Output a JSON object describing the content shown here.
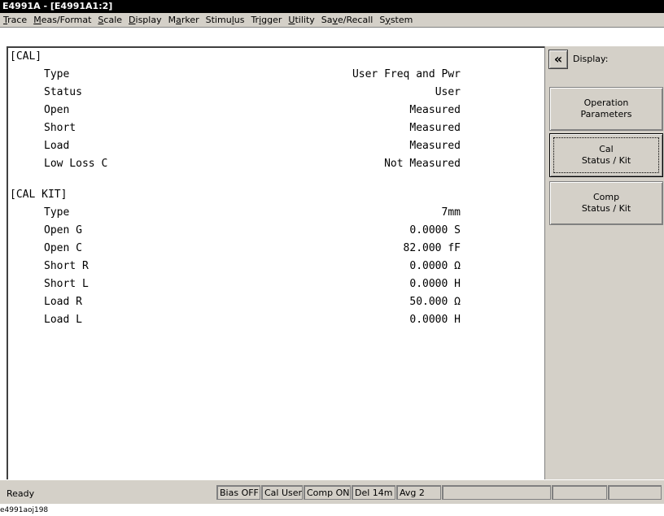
{
  "window": {
    "title": "E4991A - [E4991A1:2]"
  },
  "menu": [
    {
      "pre": "",
      "ul": "T",
      "post": "race"
    },
    {
      "pre": "",
      "ul": "M",
      "post": "eas/Format"
    },
    {
      "pre": "",
      "ul": "S",
      "post": "cale"
    },
    {
      "pre": "",
      "ul": "D",
      "post": "isplay"
    },
    {
      "pre": "M",
      "ul": "a",
      "post": "rker"
    },
    {
      "pre": "Stimu",
      "ul": "l",
      "post": "us"
    },
    {
      "pre": "Tr",
      "ul": "i",
      "post": "gger"
    },
    {
      "pre": "",
      "ul": "U",
      "post": "tility"
    },
    {
      "pre": "Sa",
      "ul": "v",
      "post": "e/Recall"
    },
    {
      "pre": "S",
      "ul": "y",
      "post": "stem"
    }
  ],
  "cal": {
    "header": "[CAL]",
    "rows": [
      {
        "label": "Type",
        "value": "User Freq and Pwr"
      },
      {
        "label": "Status",
        "value": "User"
      },
      {
        "label": "Open",
        "value": "Measured"
      },
      {
        "label": "Short",
        "value": "Measured"
      },
      {
        "label": "Load",
        "value": "Measured"
      },
      {
        "label": "Low Loss C",
        "value": "Not Measured"
      }
    ]
  },
  "calkit": {
    "header": "[CAL KIT]",
    "rows": [
      {
        "label": "Type",
        "value": "7mm"
      },
      {
        "label": "Open G",
        "value": "0.0000 S"
      },
      {
        "label": "Open C",
        "value": "82.000 fF"
      },
      {
        "label": "Short R",
        "value": "0.0000 Ω"
      },
      {
        "label": "Short L",
        "value": "0.0000 H"
      },
      {
        "label": "Load R",
        "value": "50.000 Ω"
      },
      {
        "label": "Load L",
        "value": "0.0000 H"
      }
    ]
  },
  "panel": {
    "collapse_icon": "«",
    "title": "Display:",
    "softkeys": [
      {
        "line1": "Operation",
        "line2": "Parameters"
      },
      {
        "line1": "Cal",
        "line2": "Status / Kit"
      },
      {
        "line1": "Comp",
        "line2": "Status / Kit"
      }
    ]
  },
  "status": {
    "ready": "Ready",
    "cells": [
      "Bias OFF",
      "Cal User",
      "Comp ON",
      "Del 14m",
      "Avg  2",
      "",
      "",
      ""
    ]
  },
  "caption": "e4991aoj198"
}
